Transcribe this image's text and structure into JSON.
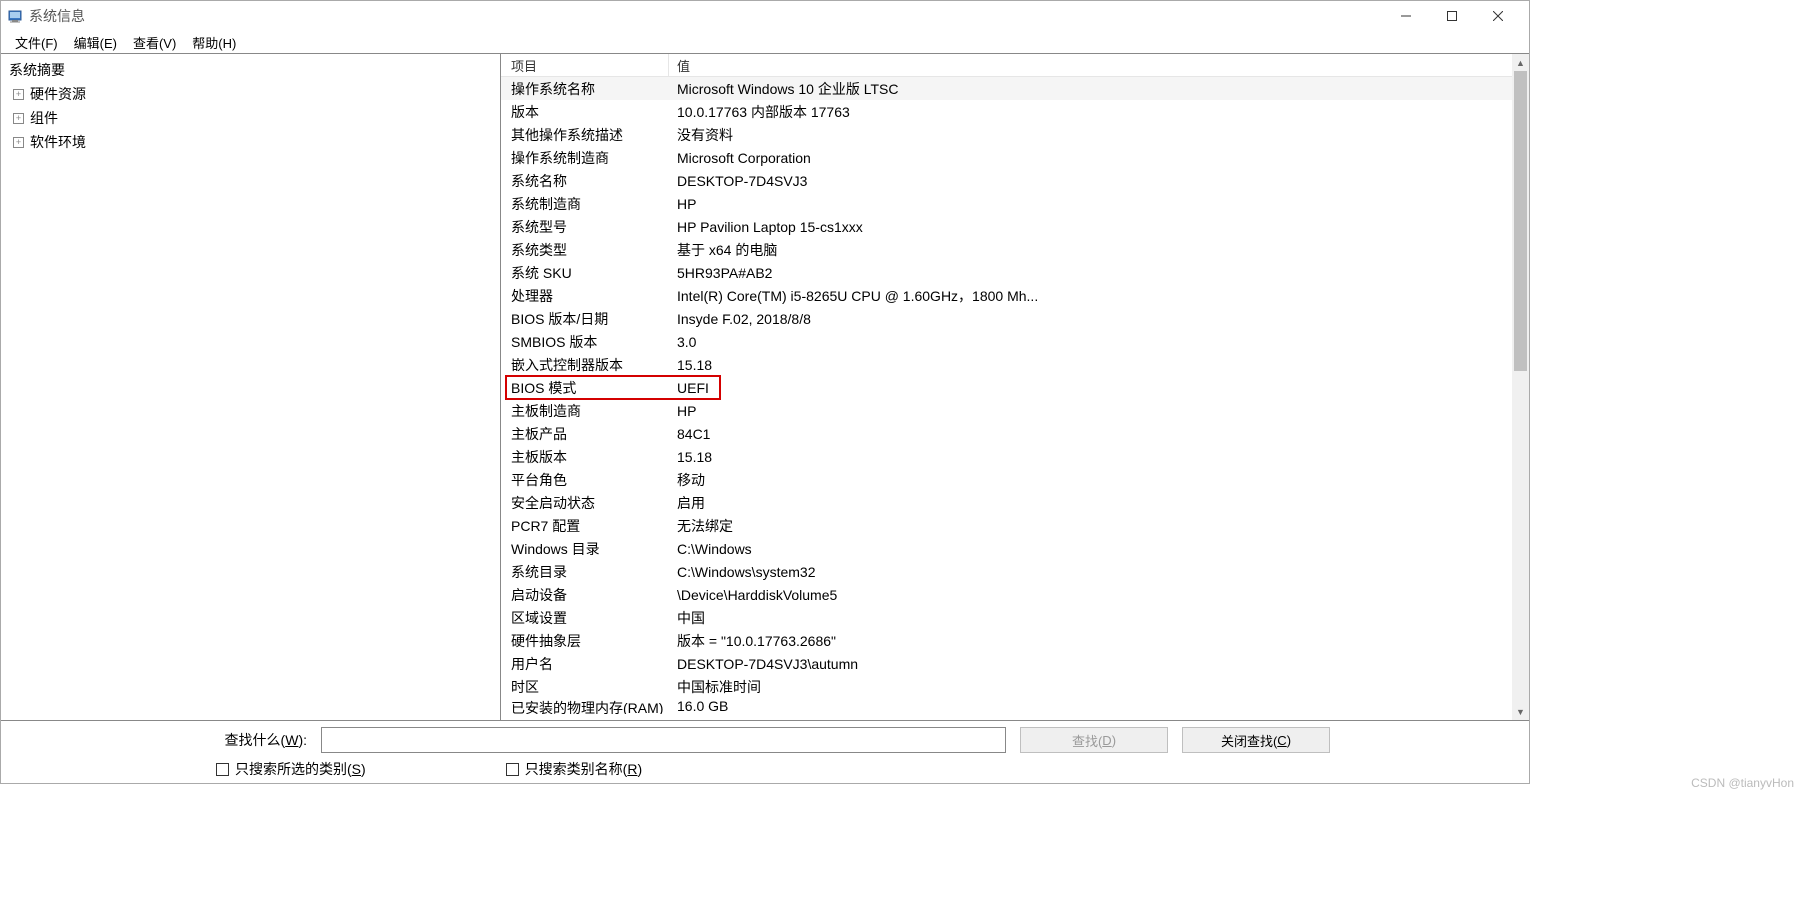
{
  "window": {
    "title": "系统信息"
  },
  "menu": {
    "file": "文件(F)",
    "edit": "编辑(E)",
    "view": "查看(V)",
    "help": "帮助(H)"
  },
  "tree": {
    "root": "系统摘要",
    "items": [
      "硬件资源",
      "组件",
      "软件环境"
    ]
  },
  "details": {
    "headers": {
      "item": "项目",
      "value": "值"
    },
    "rows": [
      {
        "item": "操作系统名称",
        "value": "Microsoft Windows 10 企业版 LTSC",
        "selected": true
      },
      {
        "item": "版本",
        "value": "10.0.17763 内部版本 17763"
      },
      {
        "item": "其他操作系统描述",
        "value": "没有资料"
      },
      {
        "item": "操作系统制造商",
        "value": "Microsoft Corporation"
      },
      {
        "item": "系统名称",
        "value": "DESKTOP-7D4SVJ3"
      },
      {
        "item": "系统制造商",
        "value": "HP"
      },
      {
        "item": "系统型号",
        "value": "HP Pavilion Laptop 15-cs1xxx"
      },
      {
        "item": "系统类型",
        "value": "基于 x64 的电脑"
      },
      {
        "item": "系统 SKU",
        "value": "5HR93PA#AB2"
      },
      {
        "item": "处理器",
        "value": "Intel(R) Core(TM) i5-8265U CPU @ 1.60GHz，1800 Mh..."
      },
      {
        "item": "BIOS 版本/日期",
        "value": "Insyde F.02, 2018/8/8"
      },
      {
        "item": "SMBIOS 版本",
        "value": "3.0"
      },
      {
        "item": "嵌入式控制器版本",
        "value": "15.18"
      },
      {
        "item": "BIOS 模式",
        "value": "UEFI",
        "highlight": true
      },
      {
        "item": "主板制造商",
        "value": "HP"
      },
      {
        "item": "主板产品",
        "value": "84C1"
      },
      {
        "item": "主板版本",
        "value": "15.18"
      },
      {
        "item": "平台角色",
        "value": "移动"
      },
      {
        "item": "安全启动状态",
        "value": "启用"
      },
      {
        "item": "PCR7 配置",
        "value": "无法绑定"
      },
      {
        "item": "Windows 目录",
        "value": "C:\\Windows"
      },
      {
        "item": "系统目录",
        "value": "C:\\Windows\\system32"
      },
      {
        "item": "启动设备",
        "value": "\\Device\\HarddiskVolume5"
      },
      {
        "item": "区域设置",
        "value": "中国"
      },
      {
        "item": "硬件抽象层",
        "value": "版本 = \"10.0.17763.2686\""
      },
      {
        "item": "用户名",
        "value": "DESKTOP-7D4SVJ3\\autumn"
      },
      {
        "item": "时区",
        "value": "中国标准时间"
      },
      {
        "item": "已安装的物理内存(RAM)",
        "value": "16.0 GB",
        "cut": true
      }
    ]
  },
  "search": {
    "label_pre": "查找什么(",
    "label_u": "W",
    "label_post": "):",
    "find_pre": "查找(",
    "find_u": "D",
    "find_post": ")",
    "close_pre": "关闭查找(",
    "close_u": "C",
    "close_post": ")",
    "check1_pre": "只搜索所选的类别(",
    "check1_u": "S",
    "check1_post": ")",
    "check2_pre": "只搜索类别名称(",
    "check2_u": "R",
    "check2_post": ")"
  },
  "watermark": "CSDN @tianyvHon"
}
